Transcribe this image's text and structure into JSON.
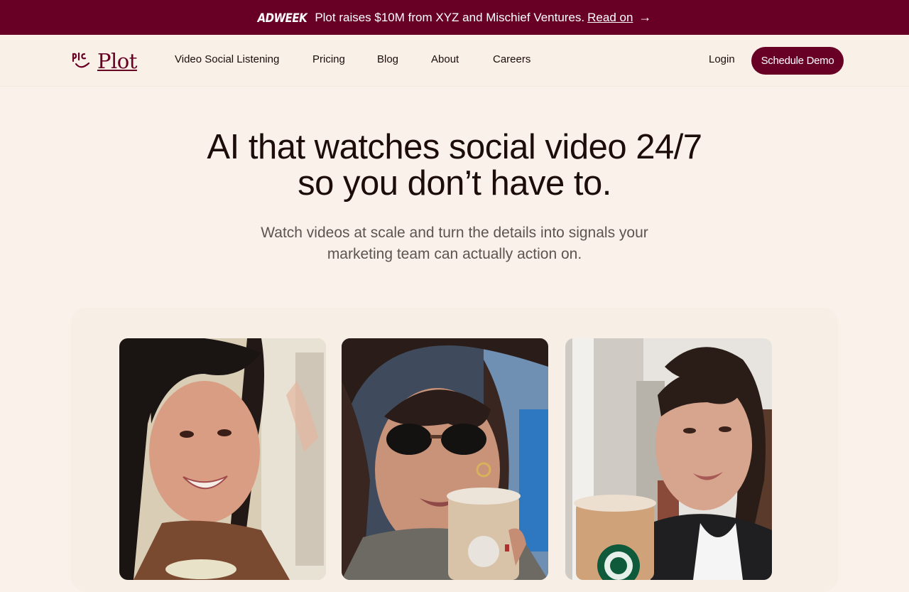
{
  "announcement": {
    "publication": "ADWEEK",
    "message": "Plot raises $10M from XYZ and Mischief Ventures.",
    "link_text": "Read on",
    "arrow": "→"
  },
  "header": {
    "logo_text": "Plot",
    "nav": [
      {
        "label": "Video Social Listening"
      },
      {
        "label": "Pricing"
      },
      {
        "label": "Blog"
      },
      {
        "label": "About"
      },
      {
        "label": "Careers"
      }
    ],
    "login_label": "Login",
    "cta_label": "Schedule Demo"
  },
  "hero": {
    "title_line1": "AI that watches social video 24/7",
    "title_line2": "so you don’t have to.",
    "subtitle_line1": "Watch videos at scale and turn the details into signals your",
    "subtitle_line2": "marketing team can actually action on."
  },
  "videos": [
    {
      "subject": "woman-with-iced-drink"
    },
    {
      "subject": "woman-with-sunglasses-and-iced-coffee"
    },
    {
      "subject": "woman-with-starbucks-cup"
    }
  ],
  "colors": {
    "brand": "#680025",
    "background": "#faf2ea",
    "text": "#1c0d0a",
    "muted_text": "#5d5350"
  }
}
